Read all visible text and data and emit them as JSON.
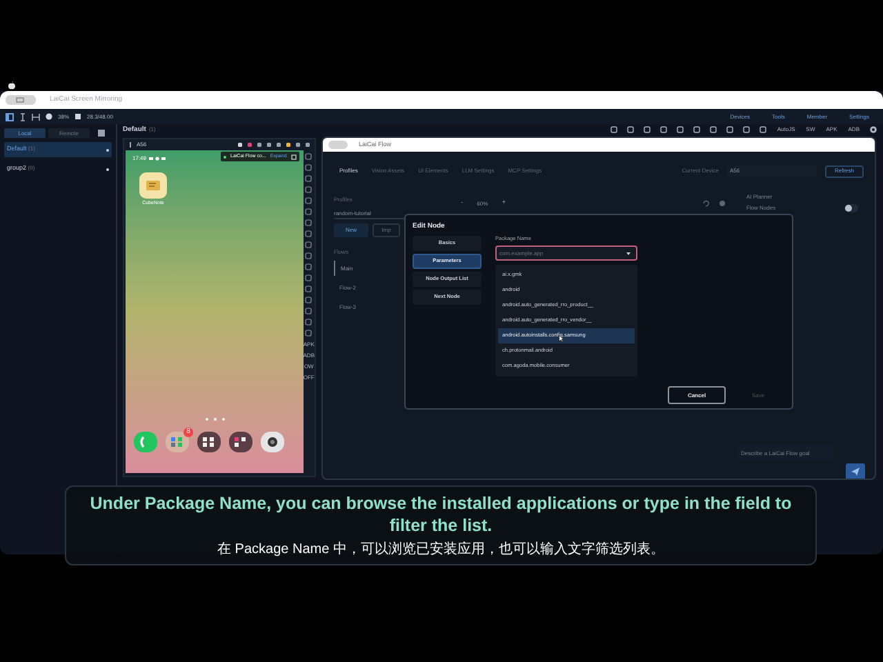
{
  "window": {
    "title": "LaiCai Screen Mirroring"
  },
  "toolbar": {
    "battery": "38%",
    "storage": "28.3/48.00",
    "menus": [
      "Devices",
      "Tools",
      "Member",
      "Settings"
    ],
    "actions": [
      "AutoJS",
      "SW",
      "APK",
      "ADB"
    ]
  },
  "sidebar": {
    "tabs": [
      {
        "label": "Local",
        "selected": true
      },
      {
        "label": "Remote",
        "selected": false
      }
    ],
    "groups": [
      {
        "name": "Default",
        "count": "(1)",
        "selected": true
      },
      {
        "name": "group2",
        "count": "(0)",
        "selected": false
      }
    ]
  },
  "group_header": {
    "title": "Default",
    "count": "(1)"
  },
  "device": {
    "name": "A56",
    "time": "17:49",
    "notification": "LaiCai Flow co...",
    "notification_action": "Expand",
    "app_label": "CubeNote",
    "dock_badge": "8",
    "side_labels": [
      "APK",
      "ADB",
      "OW",
      "OFF"
    ]
  },
  "flow_window": {
    "title": "LaiCai Flow",
    "tabs": [
      {
        "label": "Profiles",
        "selected": true
      },
      {
        "label": "Vision Assets",
        "selected": false
      },
      {
        "label": "UI Elements",
        "selected": false
      },
      {
        "label": "LLM Settings",
        "selected": false
      },
      {
        "label": "MCP Settings",
        "selected": false
      }
    ],
    "device_label": "Current Device",
    "device_value": "A56",
    "refresh": "Refresh",
    "profiles_label": "Profiles",
    "profile_value": "random-tutorial",
    "new_button": "New",
    "import_button": "Imp",
    "flows_label": "Flows",
    "flows": [
      {
        "name": "Main",
        "selected": true
      },
      {
        "name": "Flow-2",
        "selected": false
      },
      {
        "name": "Flow-3",
        "selected": false
      }
    ],
    "zoom_out": "-",
    "zoom": "60%",
    "zoom_in": "+",
    "planner_title": "AI Planner",
    "planner_flow_nodes": "Flow Nodes",
    "planner_toggle": {
      "on": false
    },
    "goal_placeholder": "Describe a LaiCai Flow goal"
  },
  "dialog": {
    "title": "Edit Node",
    "sections": [
      {
        "label": "Basics",
        "selected": false
      },
      {
        "label": "Parameters",
        "selected": true
      },
      {
        "label": "Node Output List",
        "selected": false
      },
      {
        "label": "Next Node",
        "selected": false
      }
    ],
    "field_label": "Package Name",
    "placeholder": "com.example.app",
    "options": [
      {
        "label": "ai.x.gmk",
        "selected": false
      },
      {
        "label": "android",
        "selected": false
      },
      {
        "label": "android.auto_generated_rro_product__",
        "selected": false
      },
      {
        "label": "android.auto_generated_rro_vendor__",
        "selected": false
      },
      {
        "label": "android.autoinstalls.config.samsung",
        "selected": true
      },
      {
        "label": "ch.protonmail.android",
        "selected": false
      },
      {
        "label": "com.agoda.mobile.consumer",
        "selected": false
      }
    ],
    "cancel": "Cancel",
    "save": "Save"
  },
  "subtitle": {
    "english": "Under Package Name, you can browse the installed applications or type in the field to filter the list.",
    "chinese": "在 Package Name 中，可以浏览已安装应用，也可以输入文字筛选列表。"
  }
}
